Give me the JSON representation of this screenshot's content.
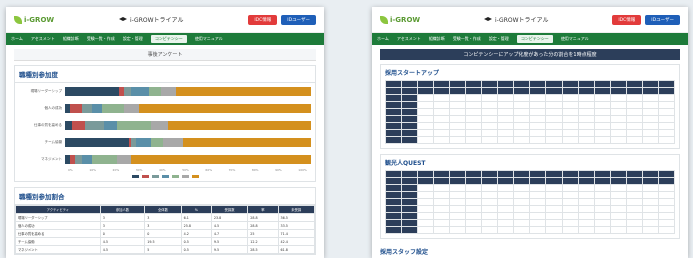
{
  "screen1": {
    "logo_text": "i-GROW",
    "app_title": "i-GROWトライアル",
    "btn_red": "IDC情報",
    "btn_blue": "IDユーザー",
    "nav": [
      "ホーム",
      "アセスメント",
      "組織診断",
      "受験一覧・作成",
      "設定・管理",
      "コンピテンシー",
      "使用マニュアル"
    ],
    "page_title": "事後アンケート",
    "panel1_title": "職種別参加度",
    "rows": [
      {
        "label": "現場リーダーシップ",
        "segs": [
          0.22,
          0.02,
          0.03,
          0.07,
          0.05,
          0.06,
          0.55
        ]
      },
      {
        "label": "個人の成功",
        "segs": [
          0.02,
          0.05,
          0.04,
          0.04,
          0.09,
          0.06,
          0.7
        ]
      },
      {
        "label": "仕事の質を高める",
        "segs": [
          0.03,
          0.05,
          0.08,
          0.05,
          0.14,
          0.07,
          0.58
        ]
      },
      {
        "label": "チーム協働",
        "segs": [
          0.26,
          0.01,
          0.02,
          0.06,
          0.05,
          0.08,
          0.52
        ]
      },
      {
        "label": "マネジメント",
        "segs": [
          0.02,
          0.02,
          0.03,
          0.04,
          0.1,
          0.06,
          0.73
        ]
      }
    ],
    "xticks": [
      "0%",
      "10%",
      "20%",
      "30%",
      "40%",
      "50%",
      "60%",
      "70%",
      "80%",
      "90%",
      "100%"
    ],
    "panel2_title": "職種別参加割合",
    "table_headers": [
      "アクティビティ",
      "参加人数",
      "全体数",
      "%",
      "受講数",
      "率",
      "未受講"
    ],
    "table_rows": [
      [
        "現場リーダーシップ",
        "3",
        "3",
        "6.1",
        "23.8",
        "28.8",
        "36.5"
      ],
      [
        "個人の成功",
        "3",
        "3",
        "25.8",
        "4.5",
        "28.8",
        "33.5"
      ],
      [
        "仕事の質を高める",
        "0",
        "0",
        "4.2",
        "4.7",
        "25",
        "71.4"
      ],
      [
        "チーム協働",
        "4.5",
        "19.5",
        "0.5",
        "9.5",
        "12.2",
        "42.4"
      ],
      [
        "マネジメント",
        "4.5",
        "5",
        "0.5",
        "9.5",
        "28.5",
        "61.8"
      ]
    ]
  },
  "screen2": {
    "logo_text": "i-GROW",
    "app_title": "i-GROWトライアル",
    "btn_red": "IDC情報",
    "btn_blue": "IDユーザー",
    "nav": [
      "ホーム",
      "アセスメント",
      "組織診断",
      "受験一覧・作成",
      "設定・管理",
      "コンピテンシー",
      "使用マニュアル"
    ],
    "banner": "コンピテンシーにアップ化度があった分の割合を1時点程度",
    "sec1_title": "採用スタートアップ",
    "sec2_title": "観光人QUEST",
    "sec3_title": "採用スタッフ設定"
  },
  "colors": {
    "green": "#1e7b3a",
    "navy": "#2c3e5a",
    "red": "#e23b3b",
    "blue": "#1f5fb8"
  },
  "seg_colors": [
    "#2c4a63",
    "#c0504d",
    "#7a9a9a",
    "#5a8fa8",
    "#8fb38f",
    "#a8a8a8",
    "#d4901e"
  ]
}
